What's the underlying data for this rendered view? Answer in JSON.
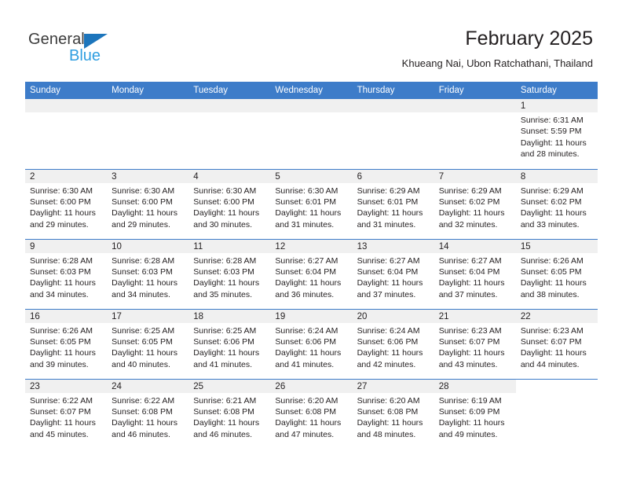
{
  "brand": {
    "name_top": "General",
    "name_bottom": "Blue",
    "triangle_color": "#1c75bc",
    "blue_text_color": "#2f9ee0"
  },
  "header": {
    "title": "February 2025",
    "subtitle": "Khueang Nai, Ubon Ratchathani, Thailand"
  },
  "theme": {
    "header_blue": "#3d7cc9",
    "daynum_band": "#f0f0f0",
    "text": "#231f20"
  },
  "columns": [
    "Sunday",
    "Monday",
    "Tuesday",
    "Wednesday",
    "Thursday",
    "Friday",
    "Saturday"
  ],
  "labels": {
    "sunrise": "Sunrise:",
    "sunset": "Sunset:",
    "daylight": "Daylight:"
  },
  "weeks": [
    [
      {
        "day": "",
        "state": "empty"
      },
      {
        "day": "",
        "state": "empty"
      },
      {
        "day": "",
        "state": "empty"
      },
      {
        "day": "",
        "state": "empty"
      },
      {
        "day": "",
        "state": "empty"
      },
      {
        "day": "",
        "state": "empty"
      },
      {
        "day": "1",
        "state": "filled",
        "sunrise": "Sunrise: 6:31 AM",
        "sunset": "Sunset: 5:59 PM",
        "daylight1": "Daylight: 11 hours",
        "daylight2": "and 28 minutes."
      }
    ],
    [
      {
        "day": "2",
        "state": "filled",
        "sunrise": "Sunrise: 6:30 AM",
        "sunset": "Sunset: 6:00 PM",
        "daylight1": "Daylight: 11 hours",
        "daylight2": "and 29 minutes."
      },
      {
        "day": "3",
        "state": "filled",
        "sunrise": "Sunrise: 6:30 AM",
        "sunset": "Sunset: 6:00 PM",
        "daylight1": "Daylight: 11 hours",
        "daylight2": "and 29 minutes."
      },
      {
        "day": "4",
        "state": "filled",
        "sunrise": "Sunrise: 6:30 AM",
        "sunset": "Sunset: 6:00 PM",
        "daylight1": "Daylight: 11 hours",
        "daylight2": "and 30 minutes."
      },
      {
        "day": "5",
        "state": "filled",
        "sunrise": "Sunrise: 6:30 AM",
        "sunset": "Sunset: 6:01 PM",
        "daylight1": "Daylight: 11 hours",
        "daylight2": "and 31 minutes."
      },
      {
        "day": "6",
        "state": "filled",
        "sunrise": "Sunrise: 6:29 AM",
        "sunset": "Sunset: 6:01 PM",
        "daylight1": "Daylight: 11 hours",
        "daylight2": "and 31 minutes."
      },
      {
        "day": "7",
        "state": "filled",
        "sunrise": "Sunrise: 6:29 AM",
        "sunset": "Sunset: 6:02 PM",
        "daylight1": "Daylight: 11 hours",
        "daylight2": "and 32 minutes."
      },
      {
        "day": "8",
        "state": "filled",
        "sunrise": "Sunrise: 6:29 AM",
        "sunset": "Sunset: 6:02 PM",
        "daylight1": "Daylight: 11 hours",
        "daylight2": "and 33 minutes."
      }
    ],
    [
      {
        "day": "9",
        "state": "filled",
        "sunrise": "Sunrise: 6:28 AM",
        "sunset": "Sunset: 6:03 PM",
        "daylight1": "Daylight: 11 hours",
        "daylight2": "and 34 minutes."
      },
      {
        "day": "10",
        "state": "filled",
        "sunrise": "Sunrise: 6:28 AM",
        "sunset": "Sunset: 6:03 PM",
        "daylight1": "Daylight: 11 hours",
        "daylight2": "and 34 minutes."
      },
      {
        "day": "11",
        "state": "filled",
        "sunrise": "Sunrise: 6:28 AM",
        "sunset": "Sunset: 6:03 PM",
        "daylight1": "Daylight: 11 hours",
        "daylight2": "and 35 minutes."
      },
      {
        "day": "12",
        "state": "filled",
        "sunrise": "Sunrise: 6:27 AM",
        "sunset": "Sunset: 6:04 PM",
        "daylight1": "Daylight: 11 hours",
        "daylight2": "and 36 minutes."
      },
      {
        "day": "13",
        "state": "filled",
        "sunrise": "Sunrise: 6:27 AM",
        "sunset": "Sunset: 6:04 PM",
        "daylight1": "Daylight: 11 hours",
        "daylight2": "and 37 minutes."
      },
      {
        "day": "14",
        "state": "filled",
        "sunrise": "Sunrise: 6:27 AM",
        "sunset": "Sunset: 6:04 PM",
        "daylight1": "Daylight: 11 hours",
        "daylight2": "and 37 minutes."
      },
      {
        "day": "15",
        "state": "filled",
        "sunrise": "Sunrise: 6:26 AM",
        "sunset": "Sunset: 6:05 PM",
        "daylight1": "Daylight: 11 hours",
        "daylight2": "and 38 minutes."
      }
    ],
    [
      {
        "day": "16",
        "state": "filled",
        "sunrise": "Sunrise: 6:26 AM",
        "sunset": "Sunset: 6:05 PM",
        "daylight1": "Daylight: 11 hours",
        "daylight2": "and 39 minutes."
      },
      {
        "day": "17",
        "state": "filled",
        "sunrise": "Sunrise: 6:25 AM",
        "sunset": "Sunset: 6:05 PM",
        "daylight1": "Daylight: 11 hours",
        "daylight2": "and 40 minutes."
      },
      {
        "day": "18",
        "state": "filled",
        "sunrise": "Sunrise: 6:25 AM",
        "sunset": "Sunset: 6:06 PM",
        "daylight1": "Daylight: 11 hours",
        "daylight2": "and 41 minutes."
      },
      {
        "day": "19",
        "state": "filled",
        "sunrise": "Sunrise: 6:24 AM",
        "sunset": "Sunset: 6:06 PM",
        "daylight1": "Daylight: 11 hours",
        "daylight2": "and 41 minutes."
      },
      {
        "day": "20",
        "state": "filled",
        "sunrise": "Sunrise: 6:24 AM",
        "sunset": "Sunset: 6:06 PM",
        "daylight1": "Daylight: 11 hours",
        "daylight2": "and 42 minutes."
      },
      {
        "day": "21",
        "state": "filled",
        "sunrise": "Sunrise: 6:23 AM",
        "sunset": "Sunset: 6:07 PM",
        "daylight1": "Daylight: 11 hours",
        "daylight2": "and 43 minutes."
      },
      {
        "day": "22",
        "state": "filled",
        "sunrise": "Sunrise: 6:23 AM",
        "sunset": "Sunset: 6:07 PM",
        "daylight1": "Daylight: 11 hours",
        "daylight2": "and 44 minutes."
      }
    ],
    [
      {
        "day": "23",
        "state": "filled",
        "sunrise": "Sunrise: 6:22 AM",
        "sunset": "Sunset: 6:07 PM",
        "daylight1": "Daylight: 11 hours",
        "daylight2": "and 45 minutes."
      },
      {
        "day": "24",
        "state": "filled",
        "sunrise": "Sunrise: 6:22 AM",
        "sunset": "Sunset: 6:08 PM",
        "daylight1": "Daylight: 11 hours",
        "daylight2": "and 46 minutes."
      },
      {
        "day": "25",
        "state": "filled",
        "sunrise": "Sunrise: 6:21 AM",
        "sunset": "Sunset: 6:08 PM",
        "daylight1": "Daylight: 11 hours",
        "daylight2": "and 46 minutes."
      },
      {
        "day": "26",
        "state": "filled",
        "sunrise": "Sunrise: 6:20 AM",
        "sunset": "Sunset: 6:08 PM",
        "daylight1": "Daylight: 11 hours",
        "daylight2": "and 47 minutes."
      },
      {
        "day": "27",
        "state": "filled",
        "sunrise": "Sunrise: 6:20 AM",
        "sunset": "Sunset: 6:08 PM",
        "daylight1": "Daylight: 11 hours",
        "daylight2": "and 48 minutes."
      },
      {
        "day": "28",
        "state": "filled",
        "sunrise": "Sunrise: 6:19 AM",
        "sunset": "Sunset: 6:09 PM",
        "daylight1": "Daylight: 11 hours",
        "daylight2": "and 49 minutes."
      },
      {
        "day": "",
        "state": "blank"
      }
    ]
  ]
}
